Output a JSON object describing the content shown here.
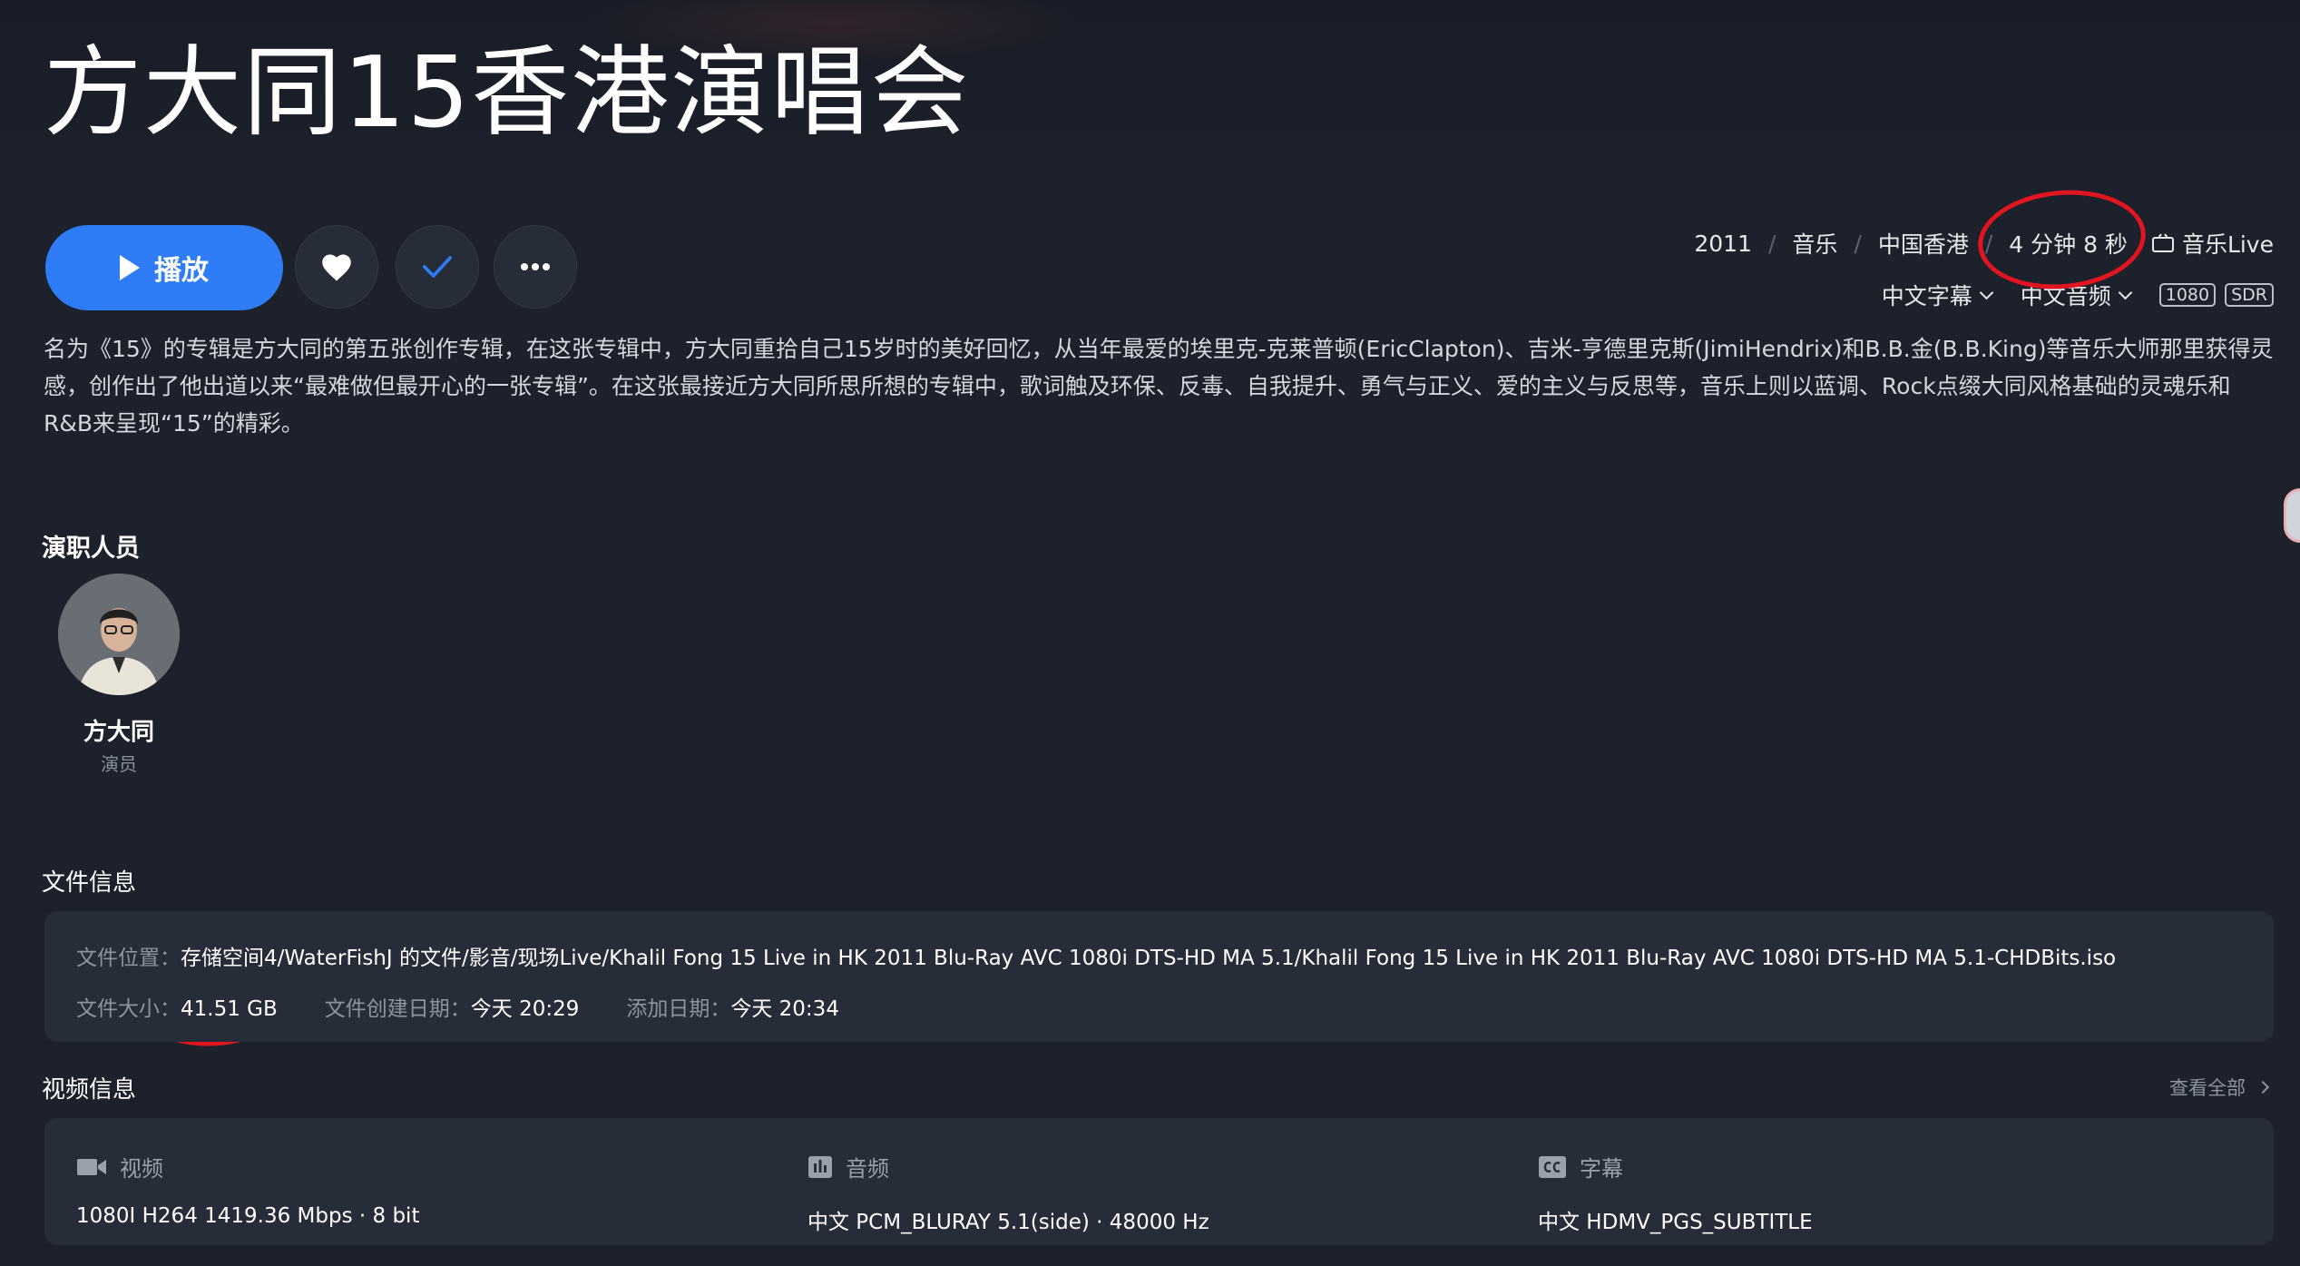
{
  "title": "方大同15香港演唱会",
  "actions": {
    "play_label": "播放"
  },
  "meta": {
    "year": "2011",
    "genre": "音乐",
    "region": "中国香港",
    "duration": "4 分钟 8 秒",
    "category": "音乐Live",
    "subtitle_select": "中文字幕",
    "audio_select": "中文音频",
    "resolution_badge": "1080",
    "hdr_badge": "SDR"
  },
  "description": "名为《15》的专辑是方大同的第五张创作专辑，在这张专辑中，方大同重拾自己15岁时的美好回忆，从当年最爱的埃里克-克莱普顿(EricClapton)、吉米-亨德里克斯(JimiHendrix)和B.B.金(B.B.King)等音乐大师那里获得灵感，创作出了他出道以来“最难做但最开心的一张专辑”。在这张最接近方大同所思所想的专辑中，歌词触及环保、反毒、自我提升、勇气与正义、爱的主义与反思等，音乐上则以蓝调、Rock点缀大同风格基础的灵魂乐和R&B来呈现“15”的精彩。",
  "cast": {
    "title": "演职人员",
    "members": [
      {
        "name": "方大同",
        "role": "演员"
      }
    ]
  },
  "file_info": {
    "title": "文件信息",
    "location_label": "文件位置：",
    "location_value": "存储空间4/WaterFishJ 的文件/影音/现场Live/Khalil Fong 15 Live in HK 2011 Blu-Ray AVC 1080i DTS-HD MA 5.1/Khalil Fong 15 Live in HK 2011 Blu-Ray AVC 1080i DTS-HD MA 5.1-CHDBits.iso",
    "size_label": "文件大小：",
    "size_value": "41.51 GB",
    "created_label": "文件创建日期：",
    "created_value": "今天 20:29",
    "added_label": "添加日期：",
    "added_value": "今天 20:34"
  },
  "video_info": {
    "title": "视频信息",
    "view_all": "查看全部",
    "video_label": "视频",
    "video_value": "1080I H264 1419.36 Mbps · 8 bit",
    "audio_label": "音频",
    "audio_value": "中文 PCM_BLURAY 5.1(side) · 48000 Hz",
    "subtitle_label": "字幕",
    "subtitle_value": "中文 HDMV_PGS_SUBTITLE"
  },
  "colors": {
    "background": "#1c212c",
    "panel": "#262c38",
    "accent": "#2f7df6",
    "annotation": "#e0151f"
  }
}
